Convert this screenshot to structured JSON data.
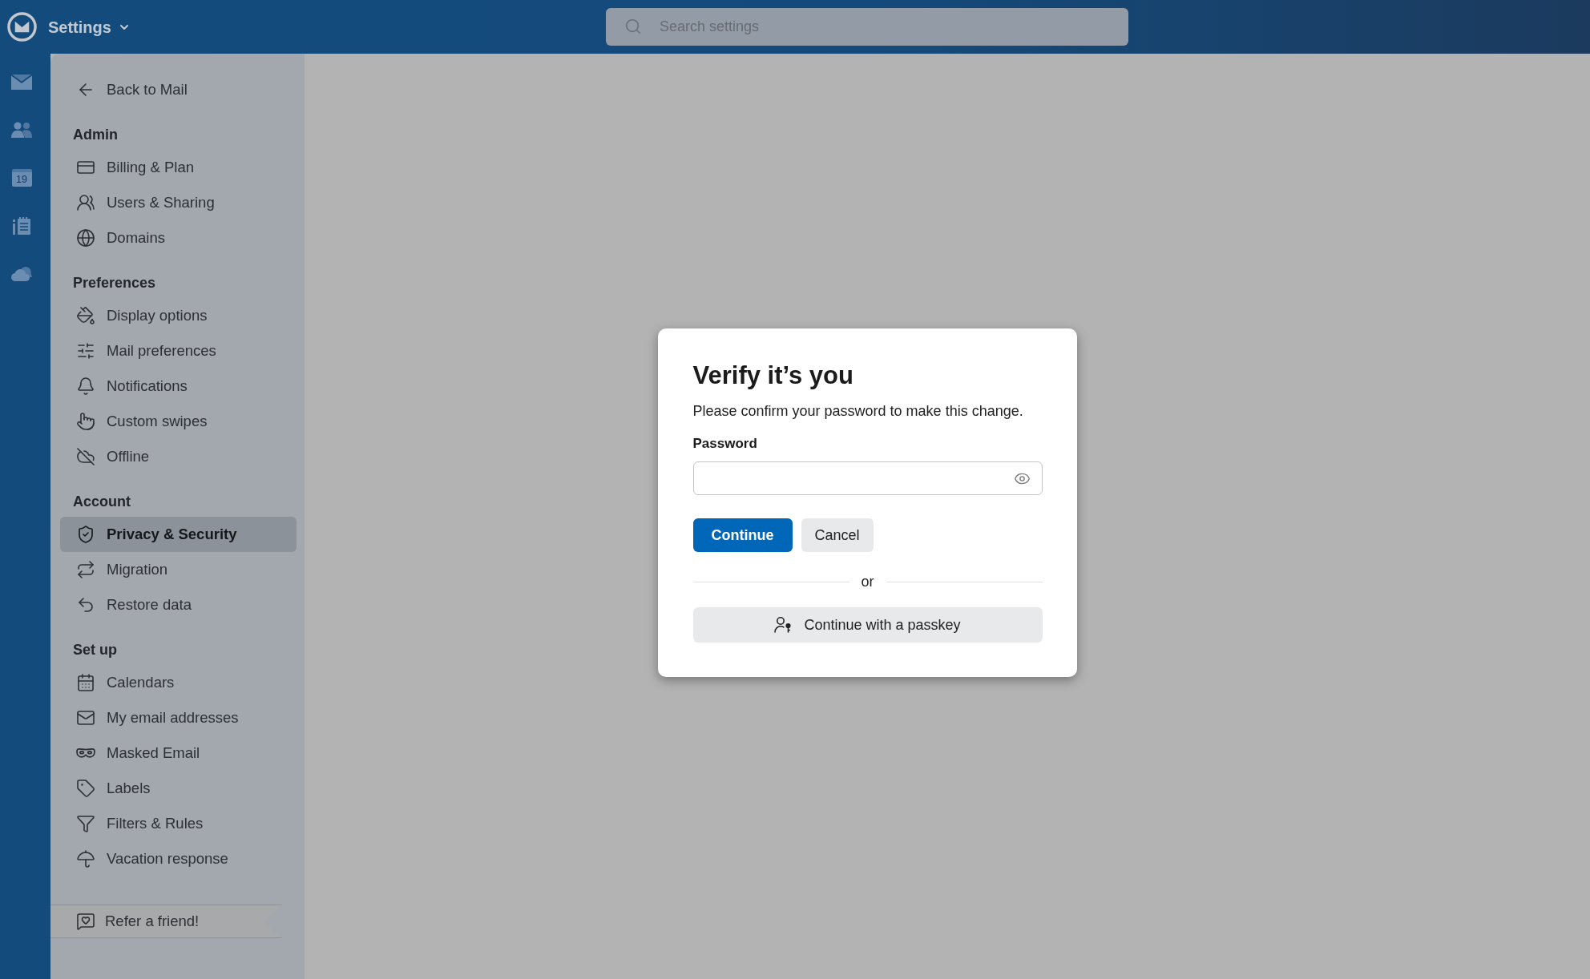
{
  "top_bar": {
    "title": "Settings",
    "search": {
      "placeholder": "Search settings"
    }
  },
  "rail": {
    "calendar_date": "19"
  },
  "sidebar": {
    "back_link": "Back to Mail",
    "sections": [
      {
        "heading": "Admin",
        "items": [
          {
            "label": "Billing & Plan",
            "selected": false
          },
          {
            "label": "Users & Sharing",
            "selected": false
          },
          {
            "label": "Domains",
            "selected": false
          }
        ]
      },
      {
        "heading": "Preferences",
        "items": [
          {
            "label": "Display options",
            "selected": false
          },
          {
            "label": "Mail preferences",
            "selected": false
          },
          {
            "label": "Notifications",
            "selected": false
          },
          {
            "label": "Custom swipes",
            "selected": false
          },
          {
            "label": "Offline",
            "selected": false
          }
        ]
      },
      {
        "heading": "Account",
        "items": [
          {
            "label": "Privacy & Security",
            "selected": true
          },
          {
            "label": "Migration",
            "selected": false
          },
          {
            "label": "Restore data",
            "selected": false
          }
        ]
      },
      {
        "heading": "Set up",
        "items": [
          {
            "label": "Calendars",
            "selected": false
          },
          {
            "label": "My email addresses",
            "selected": false
          },
          {
            "label": "Masked Email",
            "selected": false
          },
          {
            "label": "Labels",
            "selected": false
          },
          {
            "label": "Filters & Rules",
            "selected": false
          },
          {
            "label": "Vacation response",
            "selected": false
          }
        ]
      }
    ],
    "footer_link": "Refer a friend!"
  },
  "dialog": {
    "title": "Verify it’s you",
    "message": "Please confirm your password to make this change.",
    "password_field": {
      "label": "Password"
    },
    "buttons": [
      {
        "label": "Continue",
        "kind": "primary"
      },
      {
        "label": "Cancel",
        "kind": "secondary"
      }
    ],
    "separator": "or",
    "passkey_button": "Continue with a passkey"
  }
}
